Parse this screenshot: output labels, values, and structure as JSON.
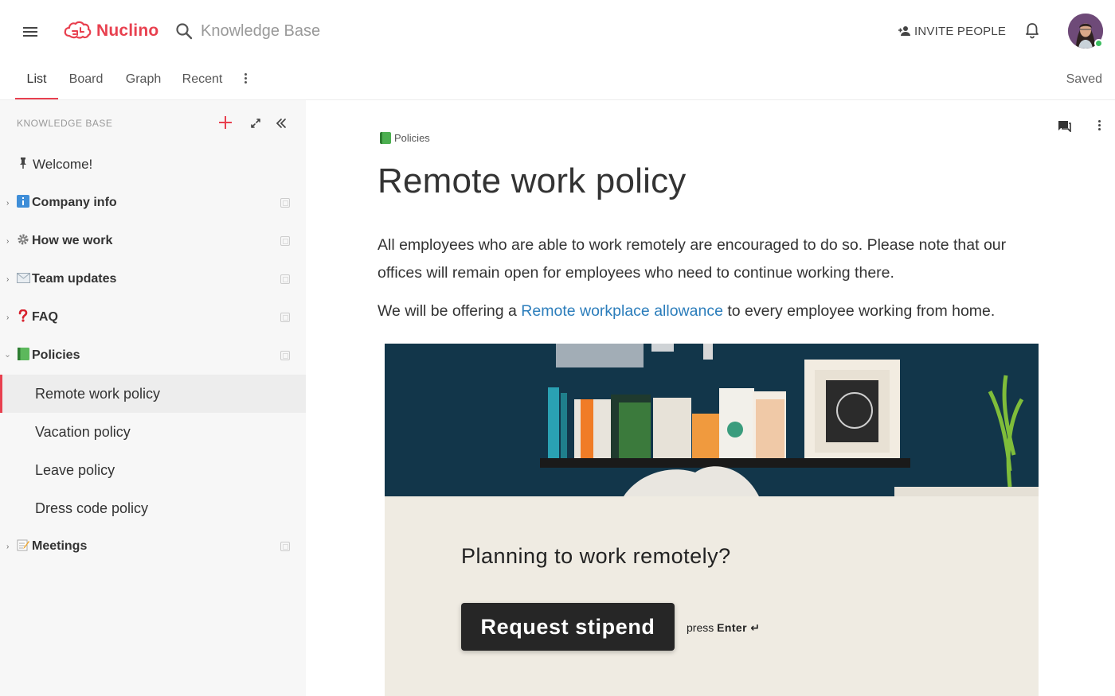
{
  "header": {
    "app_name": "Nuclino",
    "search_placeholder": "Knowledge Base",
    "invite_label": "INVITE PEOPLE"
  },
  "tabs": [
    {
      "label": "List",
      "active": true
    },
    {
      "label": "Board",
      "active": false
    },
    {
      "label": "Graph",
      "active": false
    },
    {
      "label": "Recent",
      "active": false
    }
  ],
  "status": {
    "saved": "Saved"
  },
  "sidebar": {
    "header": "KNOWLEDGE BASE",
    "items": [
      {
        "label": "Welcome!",
        "icon": "pin-icon",
        "children": []
      },
      {
        "label": "Company info",
        "icon": "info-icon"
      },
      {
        "label": "How we work",
        "icon": "gear-icon"
      },
      {
        "label": "Team updates",
        "icon": "envelope-icon"
      },
      {
        "label": "FAQ",
        "icon": "question-icon"
      },
      {
        "label": "Policies",
        "icon": "green-book-icon",
        "expanded": true,
        "children": [
          {
            "label": "Remote work policy",
            "selected": true
          },
          {
            "label": "Vacation policy"
          },
          {
            "label": "Leave policy"
          },
          {
            "label": "Dress code policy"
          }
        ]
      },
      {
        "label": "Meetings",
        "icon": "memo-icon"
      }
    ]
  },
  "document": {
    "breadcrumb": "Policies",
    "title": "Remote work policy",
    "para1": "All  employees who are able to work remotely are encouraged to do so. Please note that our offices will remain open for employees who need to continue working there.",
    "para2_before": "We will be offering a ",
    "para2_link": "Remote workplace allowance",
    "para2_after": " to every employee working from home."
  },
  "embed": {
    "question": "Planning to work remotely?",
    "button_label": "Request stipend",
    "press_prefix": "press ",
    "press_key": "Enter ↵"
  },
  "colors": {
    "brand": "#e8404f",
    "link": "#2b7dbb",
    "online": "#3bbd5f"
  }
}
